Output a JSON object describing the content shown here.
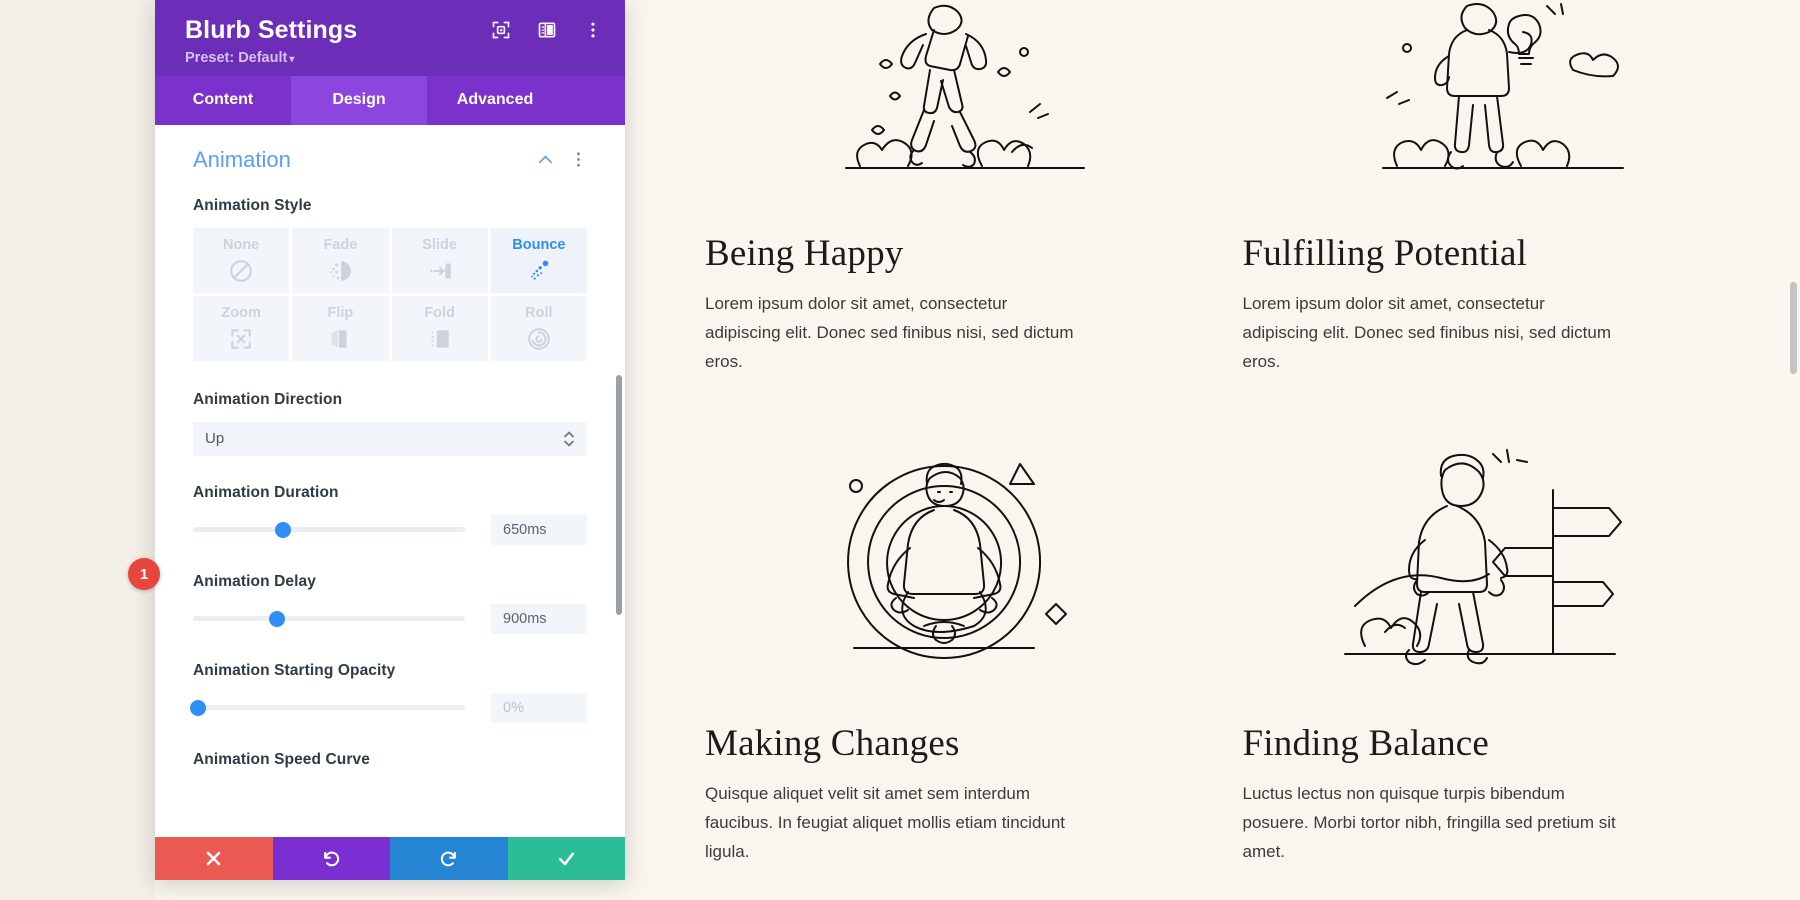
{
  "modal": {
    "title": "Blurb Settings",
    "preset_label": "Preset: Default",
    "preset_caret": "▾",
    "header_icons": [
      {
        "name": "focus-target-icon"
      },
      {
        "name": "layout-panel-icon"
      },
      {
        "name": "more-vertical-icon"
      }
    ],
    "tabs": [
      {
        "label": "Content",
        "active": false
      },
      {
        "label": "Design",
        "active": true
      },
      {
        "label": "Advanced",
        "active": false
      }
    ],
    "section": {
      "title": "Animation",
      "collapse_icon": "chevron-up-icon",
      "options_icon": "more-vertical-icon"
    },
    "animation_style": {
      "label": "Animation Style",
      "options": [
        {
          "label": "None",
          "icon": "no-entry-icon",
          "selected": false
        },
        {
          "label": "Fade",
          "icon": "fade-dots-icon",
          "selected": false
        },
        {
          "label": "Slide",
          "icon": "slide-arrow-icon",
          "selected": false
        },
        {
          "label": "Bounce",
          "icon": "bounce-arc-icon",
          "selected": true
        },
        {
          "label": "Zoom",
          "icon": "zoom-expand-icon",
          "selected": false
        },
        {
          "label": "Flip",
          "icon": "flip-book-icon",
          "selected": false
        },
        {
          "label": "Fold",
          "icon": "fold-page-icon",
          "selected": false
        },
        {
          "label": "Roll",
          "icon": "roll-spiral-icon",
          "selected": false
        }
      ]
    },
    "animation_direction": {
      "label": "Animation Direction",
      "value": "Up"
    },
    "animation_duration": {
      "label": "Animation Duration",
      "value": "650ms",
      "knob_percent": 33
    },
    "animation_delay": {
      "label": "Animation Delay",
      "value": "900ms",
      "knob_percent": 31
    },
    "animation_starting_opacity": {
      "label": "Animation Starting Opacity",
      "value": "0%",
      "knob_percent": 2
    },
    "animation_speed_curve": {
      "label": "Animation Speed Curve"
    },
    "footer": [
      {
        "name": "cancel-button",
        "icon": "close-x-icon",
        "color": "#eb5a52"
      },
      {
        "name": "undo-button",
        "icon": "undo-arrow-icon",
        "color": "#7b2ed1"
      },
      {
        "name": "redo-button",
        "icon": "redo-arrow-icon",
        "color": "#2585d4"
      },
      {
        "name": "save-button",
        "icon": "check-icon",
        "color": "#2dbd96"
      }
    ]
  },
  "step_badge": {
    "number": "1"
  },
  "content": {
    "cards": [
      {
        "title": "Being Happy",
        "text": "Lorem ipsum dolor sit amet, consectetur adipiscing elit. Donec sed finibus nisi, sed dictum eros.",
        "illustration": "person-jumping-illustration"
      },
      {
        "title": "Fulfilling Potential",
        "text": "Lorem ipsum dolor sit amet, consectetur adipiscing elit. Donec sed finibus nisi, sed dictum eros.",
        "illustration": "person-holding-lightbulb-illustration"
      },
      {
        "title": "Making Changes",
        "text": "Quisque aliquet velit sit amet sem interdum faucibus. In feugiat aliquet mollis etiam tincidunt ligula.",
        "illustration": "person-meditating-illustration"
      },
      {
        "title": "Finding Balance",
        "text": "Luctus lectus non quisque turpis bibendum posuere. Morbi tortor nibh, fringilla sed pretium sit amet.",
        "illustration": "person-at-signpost-illustration"
      }
    ]
  },
  "colors": {
    "brand_purple": "#6c2eb9",
    "tab_active": "#8d45e0",
    "accent_blue": "#2f8ef4",
    "section_blue": "#5b9df9",
    "page_background": "#faf6ef",
    "badge_red": "#e8453c"
  }
}
